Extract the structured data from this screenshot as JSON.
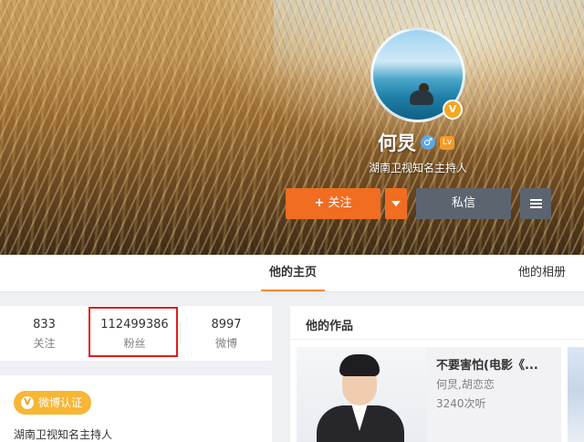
{
  "profile": {
    "name": "何炅",
    "description": "湖南卫视知名主持人",
    "verified_mark": "V",
    "gender_symbol": "♂",
    "level_badge": "Lv"
  },
  "actions": {
    "follow_label": "关注",
    "follow_plus": "+",
    "message_label": "私信"
  },
  "tabs": [
    {
      "label": "他的主页",
      "active": true
    },
    {
      "label": "他的相册",
      "active": false
    }
  ],
  "stats": [
    {
      "value": "833",
      "label": "关注"
    },
    {
      "value": "112499386",
      "label": "粉丝",
      "highlighted": true
    },
    {
      "value": "8997",
      "label": "微博"
    }
  ],
  "verify": {
    "badge_label": "微博认证",
    "badge_mark": "V",
    "text": "湖南卫视知名主持人"
  },
  "works": {
    "title": "他的作品",
    "items": [
      {
        "title": "不要害怕(电影《...",
        "cast": "何炅,胡恋恋",
        "plays": "3240次听"
      }
    ]
  },
  "colors": {
    "follow_button": "#f06d22",
    "secondary_button": "#5c6470",
    "tab_active_underline": "#f48a3a",
    "highlight_box": "#e01b1b",
    "verify_badge": "#f7b634"
  },
  "icons": [
    "male-icon",
    "level-badge-icon",
    "verified-v-icon",
    "chevron-down-icon",
    "menu-icon"
  ]
}
